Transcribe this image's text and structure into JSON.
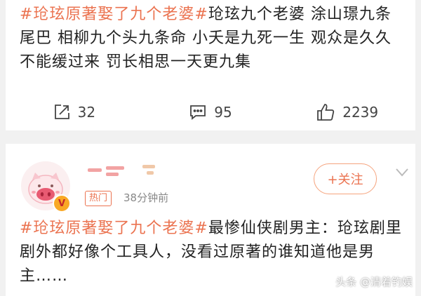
{
  "post1": {
    "tag": "#玱玹原著娶了九个老婆#",
    "text": "玱玹九个老婆 涂山璟九条尾巴 相柳九个头九条命 小夭是九死一生 观众是久久不能缓过来 罚长相思一天更九集",
    "actions": {
      "repost_count": "32",
      "comment_count": "95",
      "like_count": "2239"
    }
  },
  "post2": {
    "follow_label": "+关注",
    "hot_badge": "热门",
    "time": "38分钟前",
    "tag": "#玱玹原著娶了九个老婆#",
    "text": "最惨仙侠剧男主：玱玹剧里剧外都好像个工具人，没看过原著的谁知道他是男主……"
  },
  "watermark": "头条 @清着钓娱",
  "colors": {
    "accent": "#eb7350",
    "text": "#222222",
    "background": "#f1f1f1"
  }
}
